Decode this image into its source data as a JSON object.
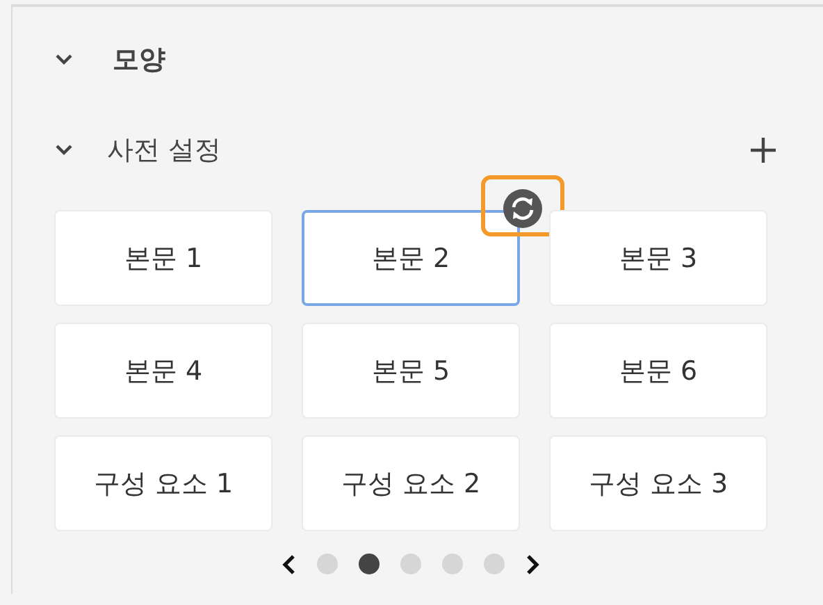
{
  "sections": [
    {
      "title": "모양",
      "expanded": true
    },
    {
      "title": "사전 설정",
      "expanded": true
    }
  ],
  "presets": [
    {
      "label": "본문 1",
      "selected": false
    },
    {
      "label": "본문 2",
      "selected": true
    },
    {
      "label": "본문 3",
      "selected": false
    },
    {
      "label": "본문 4",
      "selected": false
    },
    {
      "label": "본문 5",
      "selected": false
    },
    {
      "label": "본문 6",
      "selected": false
    },
    {
      "label": "구성 요소 1",
      "selected": false
    },
    {
      "label": "구성 요소 2",
      "selected": false
    },
    {
      "label": "구성 요소 3",
      "selected": false
    }
  ],
  "pages": [
    {
      "selected": false
    },
    {
      "selected": true
    },
    {
      "selected": false
    },
    {
      "selected": false
    },
    {
      "selected": false
    }
  ]
}
